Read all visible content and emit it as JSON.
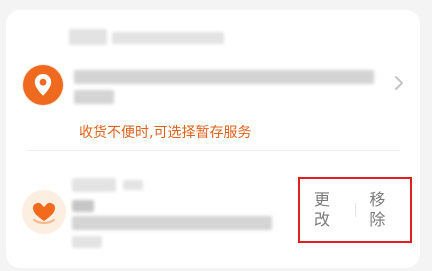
{
  "address_card": {
    "icon": "location-pin-icon",
    "accent_color": "#ef6a1e",
    "notice_text": "收货不便时,可选择暂存服务"
  },
  "service_row": {
    "icon": "heart-hand-icon",
    "edit_label": "更改",
    "remove_label": "移除",
    "highlight_color": "#e0201e"
  }
}
